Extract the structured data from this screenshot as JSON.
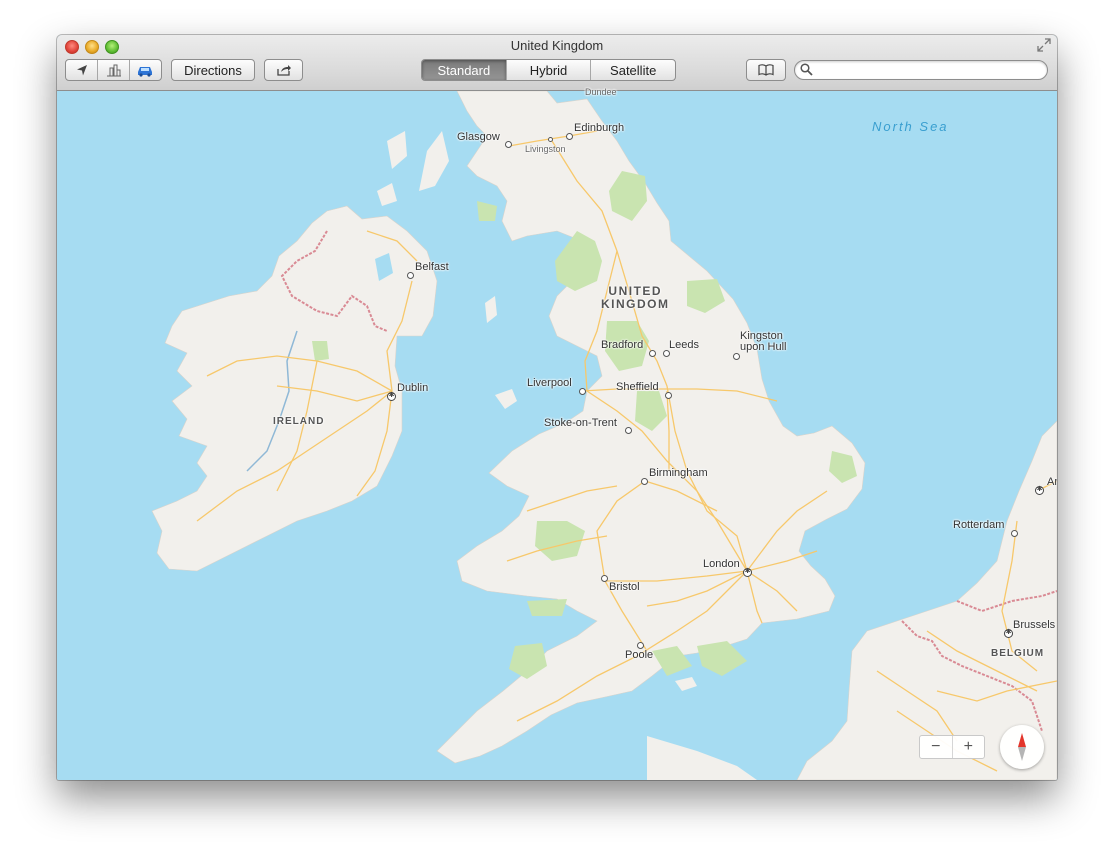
{
  "window": {
    "title": "United Kingdom"
  },
  "toolbar": {
    "directions_label": "Directions",
    "map_modes": [
      {
        "label": "Standard",
        "selected": true
      },
      {
        "label": "Hybrid",
        "selected": false
      },
      {
        "label": "Satellite",
        "selected": false
      }
    ],
    "search": {
      "placeholder": "",
      "value": ""
    },
    "icons": {
      "location": "location-arrow-icon",
      "3d": "3d-buildings-icon",
      "traffic": "car-traffic-icon",
      "share": "share-icon",
      "bookmarks": "bookmarks-icon"
    }
  },
  "map": {
    "colors": {
      "water": "#a6dcf2",
      "land": "#f2f0ec",
      "park": "#c9e4b0",
      "road": "#f7c86b",
      "border": "#d98a94"
    },
    "countries": {
      "uk_line1": "UNITED",
      "uk_line2": "KINGDOM",
      "ireland": "IRELAND",
      "belgium": "BELGIUM"
    },
    "sea": "North Sea",
    "cities": {
      "dundee": "Dundee",
      "glasgow": "Glasgow",
      "edinburgh": "Edinburgh",
      "livingston": "Livingston",
      "belfast": "Belfast",
      "bradford": "Bradford",
      "leeds": "Leeds",
      "kingston1": "Kingston",
      "kingston2": "upon Hull",
      "dublin": "Dublin",
      "liverpool": "Liverpool",
      "sheffield": "Sheffield",
      "stoke": "Stoke-on-Trent",
      "birmingham": "Birmingham",
      "rotterdam": "Rotterdam",
      "london": "London",
      "bristol": "Bristol",
      "brussels": "Brussels",
      "poole": "Poole",
      "amsterdam": "Am"
    },
    "zoom_out": "−",
    "zoom_in": "+"
  }
}
